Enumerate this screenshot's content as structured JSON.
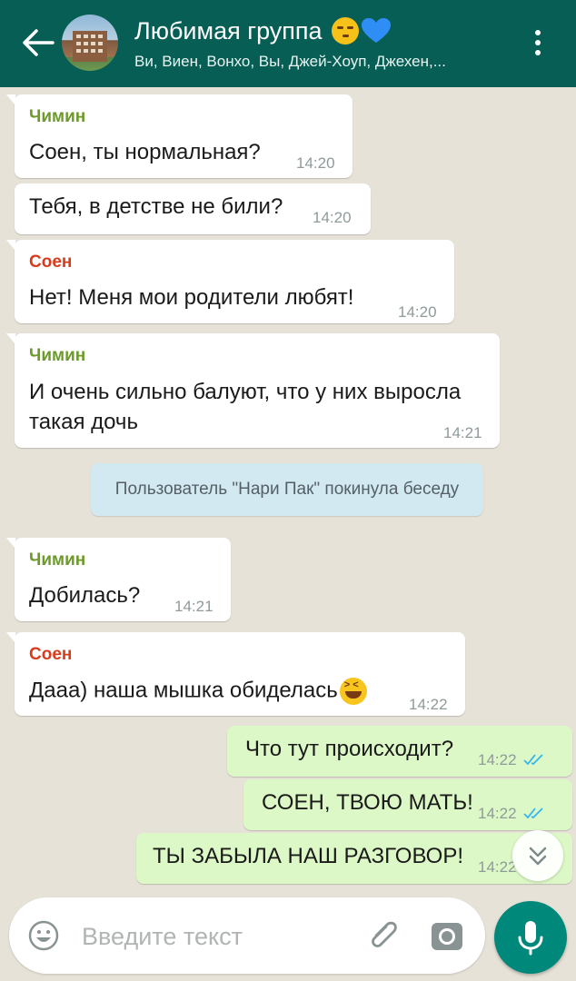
{
  "header": {
    "title": "Любимая группа",
    "subtitle": "Ви, Виен, Вонхо, Вы, Джей-Хоуп, Джехен,..."
  },
  "messages": [
    {
      "sender": "Чимин",
      "text": "Соен, ты нормальная?",
      "time": "14:20"
    },
    {
      "text": "Тебя, в детстве не били?",
      "time": "14:20"
    },
    {
      "sender": "Соен",
      "text": "Нет! Меня мои родители любят!",
      "time": "14:20"
    },
    {
      "sender": "Чимин",
      "text": "И очень сильно балуют, что у них выросла такая дочь",
      "time": "14:21"
    },
    {
      "system": "Пользователь \"Нари Пак\" покинула беседу"
    },
    {
      "sender": "Чимин",
      "text": "Добилась?",
      "time": "14:21"
    },
    {
      "sender": "Соен",
      "text": "Дааа) наша мышка обиделась",
      "time": "14:22"
    },
    {
      "text": "Что тут происходит?",
      "time": "14:22",
      "outgoing": true
    },
    {
      "text": "СОЕН, ТВОЮ МАТЬ!",
      "time": "14:22",
      "outgoing": true
    },
    {
      "text": "ТЫ ЗАБЫЛА НАШ РАЗГОВОР!",
      "time": "14:22",
      "outgoing": true
    }
  ],
  "input": {
    "placeholder": "Введите текст"
  },
  "colors": {
    "header": "#075e54",
    "outgoing_bubble": "#dcf8c6",
    "incoming_bubble": "#ffffff",
    "system_bubble": "#d2e9f2",
    "sender_chimin": "#6c9a2b",
    "sender_soen": "#d73c1c",
    "read_ticks": "#34b7f1",
    "mic_button": "#00897b"
  },
  "icons": [
    "back-arrow-icon",
    "group-avatar",
    "smirk-emoji-icon",
    "blue-heart-icon",
    "more-vert-icon",
    "laughing-emoji-icon",
    "double-check-icon",
    "scroll-down-chevron-icon",
    "emoji-icon",
    "attach-paperclip-icon",
    "camera-icon",
    "mic-icon"
  ]
}
